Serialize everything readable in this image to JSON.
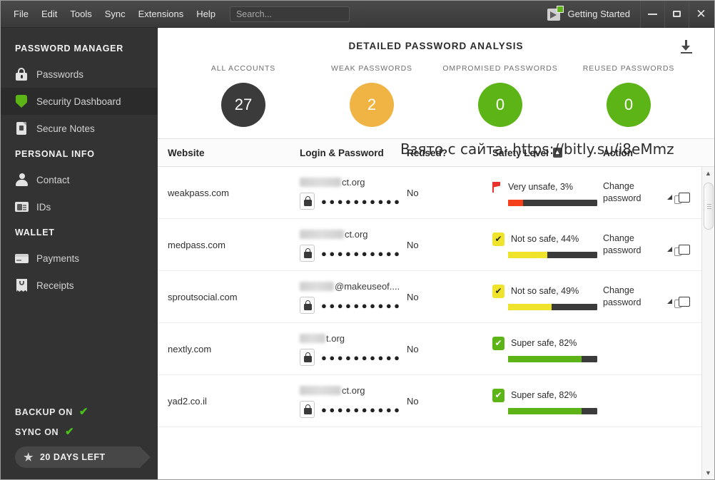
{
  "titlebar": {
    "menu": [
      "File",
      "Edit",
      "Tools",
      "Sync",
      "Extensions",
      "Help"
    ],
    "search_placeholder": "Search...",
    "getting_started": "Getting Started",
    "close_glyph": "✕"
  },
  "sidebar": {
    "groups": [
      {
        "title": "PASSWORD MANAGER",
        "items": [
          {
            "label": "Passwords",
            "icon": "lock-icon",
            "active": false
          },
          {
            "label": "Security Dashboard",
            "icon": "shield-icon",
            "active": true
          },
          {
            "label": "Secure Notes",
            "icon": "note-lock-icon",
            "active": false
          }
        ]
      },
      {
        "title": "PERSONAL INFO",
        "items": [
          {
            "label": "Contact",
            "icon": "user-icon",
            "active": false
          },
          {
            "label": "IDs",
            "icon": "id-card-icon",
            "active": false
          }
        ]
      },
      {
        "title": "WALLET",
        "items": [
          {
            "label": "Payments",
            "icon": "credit-card-icon",
            "active": false
          },
          {
            "label": "Receipts",
            "icon": "receipt-icon",
            "active": false
          }
        ]
      }
    ],
    "footer": {
      "backup_label": "BACKUP ON",
      "sync_label": "SYNC ON",
      "check_glyph": "✔",
      "trial_label": "20 DAYS LEFT",
      "star_glyph": "★"
    }
  },
  "main": {
    "title": "DETAILED PASSWORD ANALYSIS",
    "download_icon": "download-icon",
    "stats": [
      {
        "label": "ALL ACCOUNTS",
        "value": "27",
        "color": "#3b3b3b"
      },
      {
        "label": "WEAK PASSWORDS",
        "value": "2",
        "color": "#f0b445"
      },
      {
        "label": "OMPROMISED PASSWORDS",
        "value": "0",
        "color": "#5cb416"
      },
      {
        "label": "REUSED PASSWORDS",
        "value": "0",
        "color": "#5cb416"
      }
    ],
    "table": {
      "headers": {
        "website": "Website",
        "login": "Login & Password",
        "reused": "Reused?",
        "safety": "Safety Level",
        "action": "Action"
      },
      "rows": [
        {
          "website": "weakpass.com",
          "login_suffix": "ct.org",
          "login_blur_width": 58,
          "password_dots": "●●●●●●●●●●",
          "reused": "No",
          "safety_text": "Very unsafe, 3%",
          "safety_percent": 3,
          "bar_fill_percent": 17,
          "bar_color": "#f4411c",
          "marker": "flag",
          "marker_color": "#e8322b",
          "action": "Change\npassword",
          "action_type": "link",
          "has_open_icon": true
        },
        {
          "website": "medpass.com",
          "login_suffix": "ct.org",
          "login_blur_width": 62,
          "password_dots": "●●●●●●●●●●",
          "reused": "No",
          "safety_text": "Not so safe, 44%",
          "safety_percent": 44,
          "bar_fill_percent": 44,
          "bar_color": "#f0e32c",
          "marker": "tick-yellow",
          "marker_color": "#f0e32c",
          "action": "Change\npassword",
          "action_type": "link",
          "has_open_icon": true
        },
        {
          "website": "sproutsocial.com",
          "login_suffix": "@makeuseof....",
          "login_blur_width": 48,
          "password_dots": "●●●●●●●●●●",
          "reused": "No",
          "safety_text": "Not so safe, 49%",
          "safety_percent": 49,
          "bar_fill_percent": 49,
          "bar_color": "#f0e32c",
          "marker": "tick-yellow",
          "marker_color": "#f0e32c",
          "action": "Change\npassword",
          "action_type": "link",
          "has_open_icon": true
        },
        {
          "website": "nextly.com",
          "login_suffix": "t.org",
          "login_blur_width": 36,
          "password_dots": "●●●●●●●●●●",
          "reused": "No",
          "safety_text": "Super safe, 82%",
          "safety_percent": 82,
          "bar_fill_percent": 82,
          "bar_color": "#5cb416",
          "marker": "tick-green",
          "marker_color": "#5cb416",
          "action": "",
          "action_type": "dash",
          "has_open_icon": false
        },
        {
          "website": "yad2.co.il",
          "login_suffix": "ct.org",
          "login_blur_width": 58,
          "password_dots": "●●●●●●●●●●",
          "reused": "No",
          "safety_text": "Super safe, 82%",
          "safety_percent": 82,
          "bar_fill_percent": 82,
          "bar_color": "#5cb416",
          "marker": "tick-green",
          "marker_color": "#5cb416",
          "action": "",
          "action_type": "dash",
          "has_open_icon": false
        }
      ]
    },
    "scrollbar": {
      "up_glyph": "▲",
      "down_glyph": "▼"
    }
  },
  "watermark": "Взято с сайта: https://bitly.su/i8eMmz"
}
